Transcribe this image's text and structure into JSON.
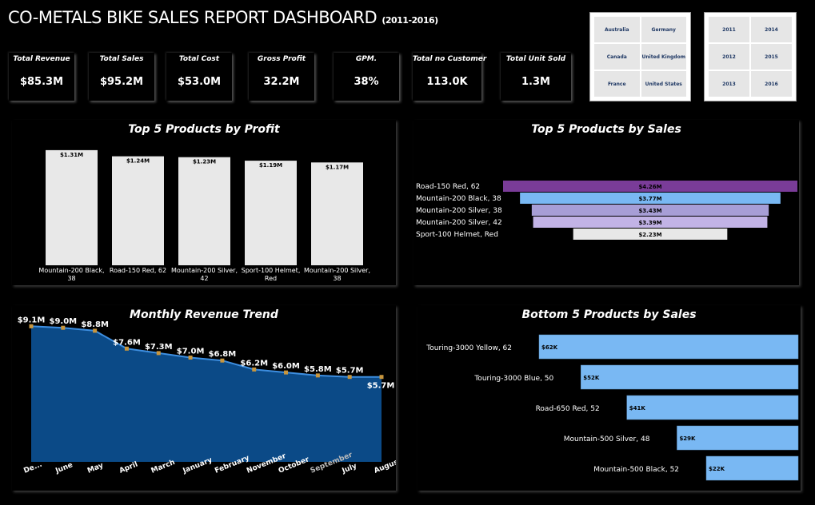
{
  "header": {
    "title": "CO-METALS BIKE SALES REPORT DASHBOARD",
    "subtitle": "(2011-2016)"
  },
  "kpis": [
    {
      "label": "Total Revenue",
      "value": "$85.3M"
    },
    {
      "label": "Total Sales",
      "value": "$95.2M"
    },
    {
      "label": "Total Cost",
      "value": "$53.0M"
    },
    {
      "label": "Gross Profit",
      "value": "32.2M"
    },
    {
      "label": "GPM.",
      "value": "38%"
    },
    {
      "label": "Total no Customer",
      "value": "113.0K"
    },
    {
      "label": "Total Unit Sold",
      "value": "1.3M"
    }
  ],
  "slicers": {
    "countries": [
      "Australia",
      "Germany",
      "Canada",
      "United Kingdom",
      "France",
      "United States"
    ],
    "years": [
      "2011",
      "2014",
      "2012",
      "2015",
      "2013",
      "2016"
    ]
  },
  "colors": {
    "background": "#000000",
    "area_fill": "#0b4a87",
    "area_line": "#3d8ee0",
    "marker": "#c8963e",
    "light_blue": "#79b8f3",
    "purple": "#7a3c98",
    "lavender_1": "#a79ed6",
    "lavender_2": "#c2b3e6",
    "light_gray": "#e8e8e8"
  },
  "chart_data": [
    {
      "type": "bar",
      "title": "Top 5 Products by Profit",
      "categories": [
        "Mountain-200 Black, 38",
        "Road-150 Red, 62",
        "Mountain-200 Silver, 42",
        "Sport-100 Helmet, Red",
        "Mountain-200 Silver, 38"
      ],
      "category_lines": [
        [
          "Mountain-200 Black,",
          "38"
        ],
        [
          "Road-150 Red, 62"
        ],
        [
          "Mountain-200 Silver,",
          "42"
        ],
        [
          "Sport-100 Helmet,",
          "Red"
        ],
        [
          "Mountain-200 Silver,",
          "38"
        ]
      ],
      "values": [
        1.31,
        1.24,
        1.23,
        1.19,
        1.17
      ],
      "data_labels": [
        "$1.31M",
        "$1.24M",
        "$1.23M",
        "$1.19M",
        "$1.17M"
      ],
      "ylim": [
        0,
        1.4
      ]
    },
    {
      "type": "bar",
      "orientation": "horizontal-funnel",
      "title": "Top 5 Products by Sales",
      "categories": [
        "Road-150 Red, 62",
        "Mountain-200 Black, 38",
        "Mountain-200 Silver, 38",
        "Mountain-200 Silver, 42",
        "Sport-100 Helmet, Red"
      ],
      "values": [
        4.26,
        3.77,
        3.43,
        3.39,
        2.23
      ],
      "data_labels": [
        "$4.26M",
        "$3.77M",
        "$3.43M",
        "$3.39M",
        "$2.23M"
      ],
      "bar_colors": [
        "#7a3c98",
        "#79b8f3",
        "#a79ed6",
        "#c2b3e6",
        "#e8e8e8"
      ]
    },
    {
      "type": "area",
      "title": "Monthly Revenue Trend",
      "categories": [
        "De...",
        "June",
        "May",
        "April",
        "March",
        "January",
        "February",
        "November",
        "October",
        "September",
        "July",
        "August"
      ],
      "values": [
        9.1,
        9.0,
        8.8,
        7.6,
        7.3,
        7.0,
        6.8,
        6.2,
        6.0,
        5.8,
        5.7,
        5.7
      ],
      "data_labels": [
        "$9.1M",
        "$9.0M",
        "$8.8M",
        "$7.6M",
        "$7.3M",
        "$7.0M",
        "$6.8M",
        "$6.2M",
        "$6.0M",
        "$5.8M",
        "$5.7M",
        "$5.7M"
      ],
      "ylim": [
        0,
        9.6
      ]
    },
    {
      "type": "bar",
      "orientation": "horizontal",
      "title": "Bottom 5 Products by Sales",
      "categories": [
        "Touring-3000 Yellow, 62",
        "Touring-3000 Blue, 50",
        "Road-650 Red, 52",
        "Mountain-500 Silver, 48",
        "Mountain-500 Black, 52"
      ],
      "values": [
        62,
        52,
        41,
        29,
        22
      ],
      "data_labels": [
        "$62K",
        "$52K",
        "$41K",
        "$29K",
        "$22K"
      ]
    }
  ]
}
